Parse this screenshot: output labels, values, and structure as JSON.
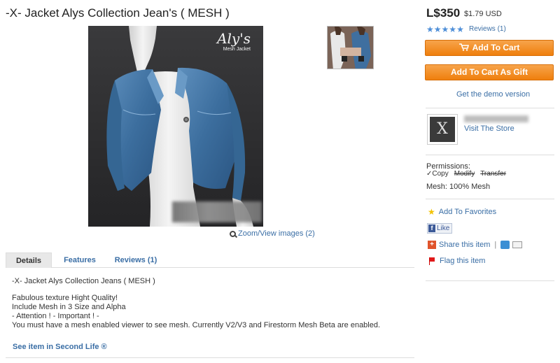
{
  "product": {
    "title": "-X- Jacket Alys Collection Jean's ( MESH )",
    "image_logo": "Aly's",
    "image_logo_sub": "Mesh Jacket",
    "zoom_link": "Zoom/View images (2)"
  },
  "purchase": {
    "price": "L$350",
    "usd": "$1.79 USD",
    "rating_stars": 5,
    "reviews_link": "Reviews (1)",
    "add_to_cart": "Add To Cart",
    "add_to_cart_gift": "Add To Cart As Gift",
    "demo_link": "Get the demo version"
  },
  "store": {
    "logo_glyph": "X",
    "visit_store": "Visit The Store"
  },
  "permissions": {
    "label": "Permissions:",
    "copy": "✓Copy",
    "modify": "Modify",
    "transfer": "Transfer",
    "mesh": "Mesh: 100% Mesh"
  },
  "actions": {
    "favorites": "Add To Favorites",
    "like": "Like",
    "share": "Share this item",
    "share_pipe": "|",
    "flag": "Flag this item"
  },
  "tabs": [
    {
      "label": "Details",
      "active": true
    },
    {
      "label": "Features",
      "active": false
    },
    {
      "label": "Reviews (1)",
      "active": false
    }
  ],
  "details": {
    "heading": "-X- Jacket Alys Collection Jeans ( MESH )",
    "line1": "Fabulous texture Hight Quality!",
    "line2": "Include Mesh in 3 Size and Alpha",
    "line3": "- Attention ! - Important ! -",
    "line4": "You must have a mesh enabled viewer to see mesh. Currently V2/V3 and Firestorm Mesh Beta are enabled.",
    "second_life_link": "See item in Second Life ®"
  },
  "colors": {
    "accent_orange": "#ef7f0d",
    "link_blue": "#3a6ea5",
    "star_blue": "#4f8fd8"
  }
}
